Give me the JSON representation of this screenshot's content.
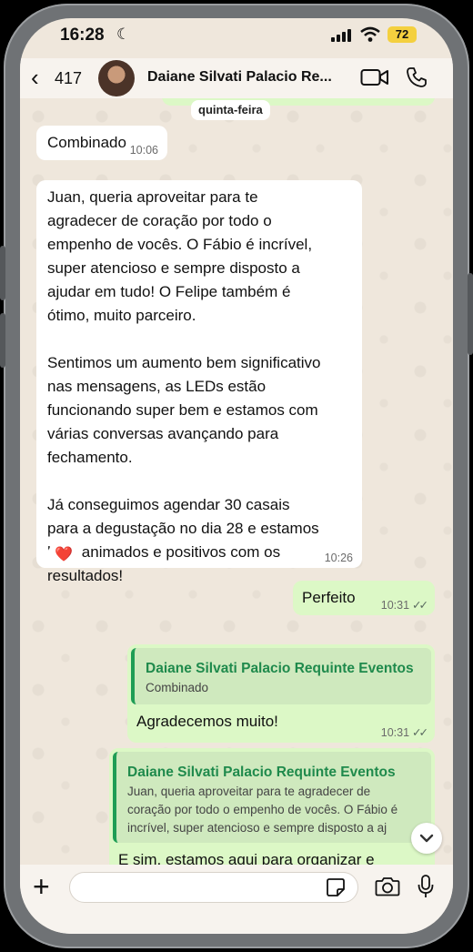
{
  "status_bar": {
    "time": "16:28",
    "battery": "72"
  },
  "header": {
    "back_count": "417",
    "contact_name": "Daiane Silvati Palacio Re..."
  },
  "chat": {
    "day_label": "quinta-feira",
    "messages": [
      {
        "text": "Combinado",
        "time": "10:06"
      },
      {
        "lines": [
          "Juan, queria aproveitar para te",
          "agradecer de coração por todo o",
          "empenho de vocês. O Fábio é incrível,",
          "super atencioso e sempre disposto a",
          "ajudar em tudo! O Felipe também é",
          "ótimo, muito parceiro.",
          "",
          "Sentimos um aumento bem significativo",
          "nas mensagens, as LEDs estão",
          "funcionando super bem e estamos com",
          "várias conversas avançando para",
          "fechamento.",
          "",
          "Já conseguimos agendar 30 casais",
          "para a degustação no dia 28 e estamos",
          "bem animados e positivos com os",
          "resultados!"
        ],
        "time": "10:26",
        "reaction": "❤️"
      },
      {
        "text": "Perfeito",
        "time": "10:31"
      },
      {
        "quote_name": "Daiane Silvati Palacio Requinte Eventos",
        "quote_text": "Combinado",
        "text": "Agradecemos muito!",
        "time": "10:31"
      },
      {
        "quote_name": "Daiane Silvati Palacio Requinte Eventos",
        "quote_lines": [
          "Juan, queria aproveitar para te agradecer de",
          "coração por todo o empenho de vocês. O Fábio é",
          "incrível, super atencioso e sempre disposto a aj"
        ],
        "text": "E sim, estamos aqui para organizar e"
      }
    ]
  },
  "input_bar": {
    "placeholder": ""
  },
  "icons": {
    "back": "chevron-left-icon",
    "video": "video-camera-icon",
    "phone": "phone-icon",
    "plus": "plus-icon",
    "sticker": "sticker-icon",
    "camera": "camera-icon",
    "mic": "microphone-icon",
    "scroll": "chevron-down-icon"
  },
  "colors": {
    "outgoing_bubble": "#dcf8c6",
    "incoming_bubble": "#ffffff",
    "quote_accent": "#1f9d55",
    "chat_bg": "#efe7dc"
  }
}
